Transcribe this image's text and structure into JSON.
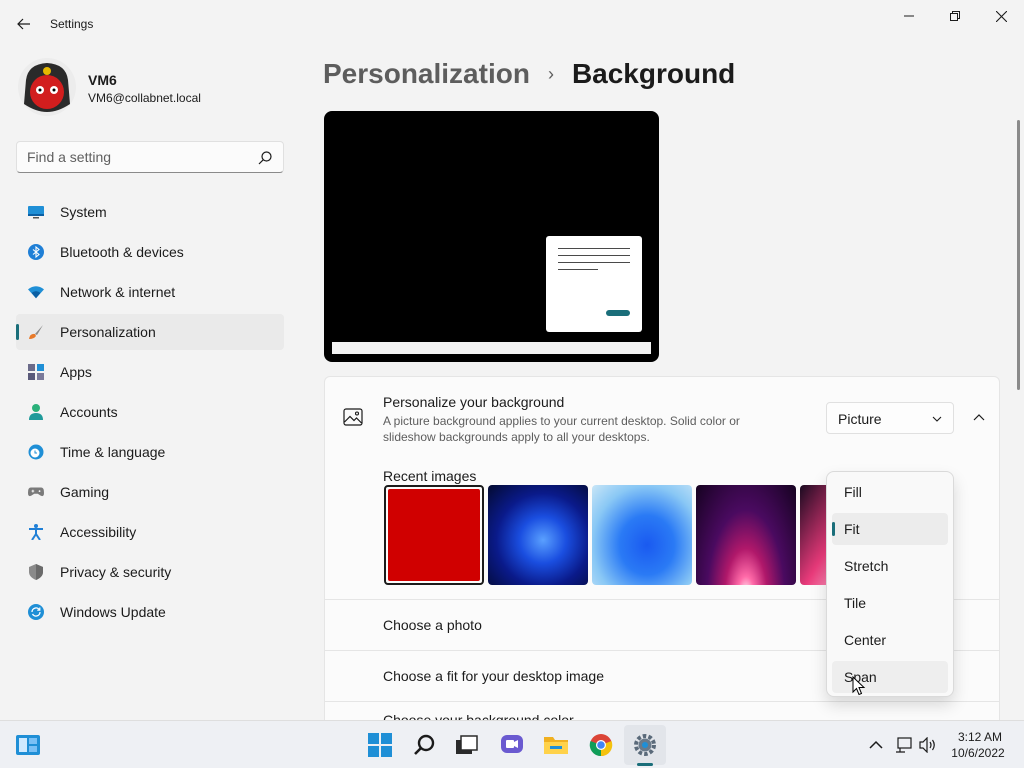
{
  "window": {
    "title": "Settings"
  },
  "profile": {
    "name": "VM6",
    "email": "VM6@collabnet.local"
  },
  "search": {
    "placeholder": "Find a setting"
  },
  "sidebar": {
    "items": [
      {
        "label": "System",
        "icon": "monitor-icon"
      },
      {
        "label": "Bluetooth & devices",
        "icon": "bluetooth-icon"
      },
      {
        "label": "Network & internet",
        "icon": "wifi-icon"
      },
      {
        "label": "Personalization",
        "icon": "paintbrush-icon",
        "selected": true
      },
      {
        "label": "Apps",
        "icon": "apps-icon"
      },
      {
        "label": "Accounts",
        "icon": "person-icon"
      },
      {
        "label": "Time & language",
        "icon": "clock-globe-icon"
      },
      {
        "label": "Gaming",
        "icon": "gamepad-icon"
      },
      {
        "label": "Accessibility",
        "icon": "accessibility-icon"
      },
      {
        "label": "Privacy & security",
        "icon": "shield-icon"
      },
      {
        "label": "Windows Update",
        "icon": "update-icon"
      }
    ]
  },
  "breadcrumb": {
    "parent": "Personalization",
    "separator": "›",
    "current": "Background"
  },
  "background": {
    "title": "Personalize your background",
    "description": "A picture background applies to your current desktop. Solid color or slideshow backgrounds apply to all your desktops.",
    "type_value": "Picture",
    "recent_images_label": "Recent images",
    "recent_images": [
      {
        "name": "red-solid",
        "selected": true
      },
      {
        "name": "blue-bloom-dark"
      },
      {
        "name": "blue-bloom-light"
      },
      {
        "name": "purple-glow"
      },
      {
        "name": "pink-flow"
      }
    ],
    "choose_photo_label": "Choose a photo",
    "choose_fit_label": "Choose a fit for your desktop image",
    "choose_color_label": "Choose your background color"
  },
  "fit_dropdown": {
    "options": [
      "Fill",
      "Fit",
      "Stretch",
      "Tile",
      "Center",
      "Span"
    ],
    "selected": "Fit",
    "hovered": "Span"
  },
  "taskbar": {
    "time": "3:12 AM",
    "date": "10/6/2022",
    "apps": [
      "widgets-icon",
      "start-icon",
      "search-icon",
      "task-view-icon",
      "chat-icon",
      "file-explorer-icon",
      "chrome-icon",
      "settings-icon"
    ]
  },
  "colors": {
    "accent": "#1a6e7a",
    "background": "#f3f3f3",
    "card": "#fbfbfb"
  }
}
